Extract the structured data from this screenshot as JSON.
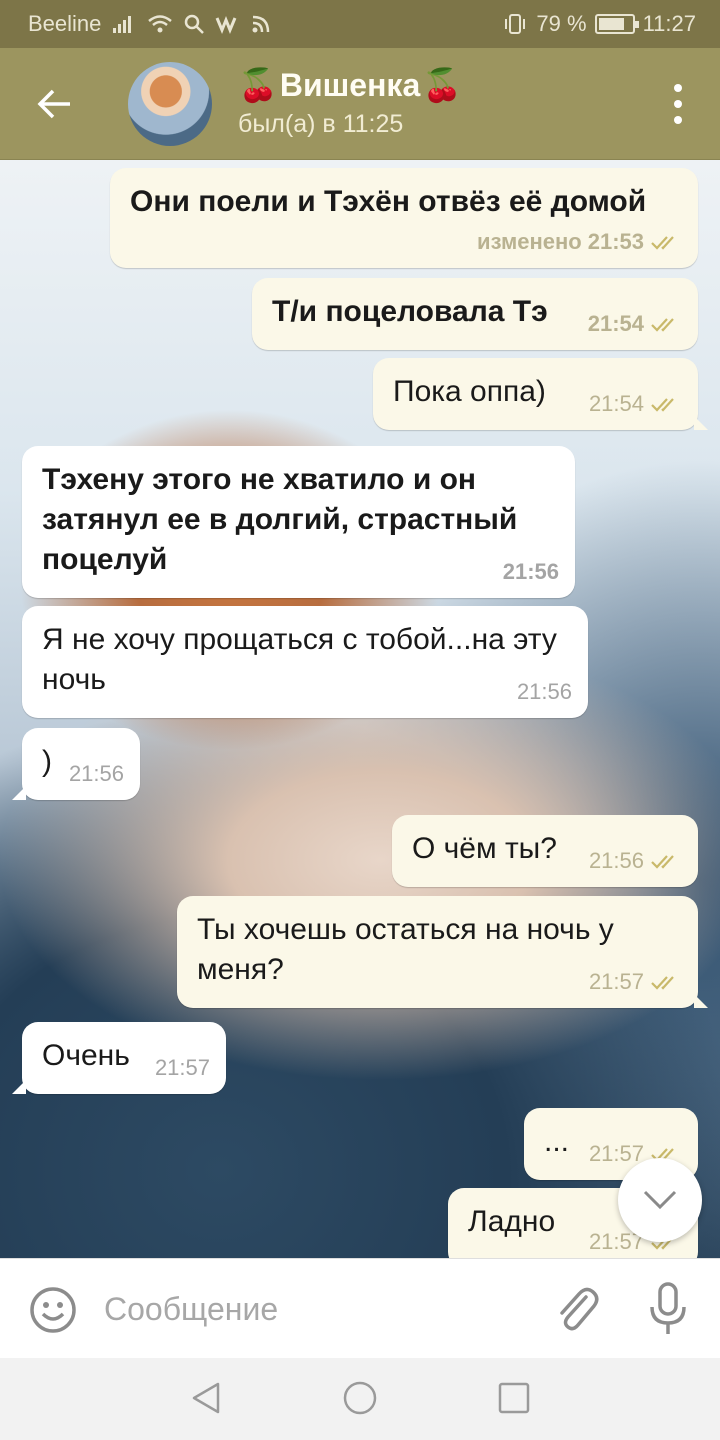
{
  "status_bar": {
    "carrier": "Beeline",
    "battery": "79 %",
    "battery_level": 0.79,
    "time": "11:27"
  },
  "header": {
    "name_emoji": "🍒",
    "name": "Вишенка",
    "status": "был(а) в 11:25"
  },
  "messages": [
    {
      "direction": "out",
      "text": "Они поели и Тэхён отвёз её домой",
      "edited": "изменено",
      "time": "21:53",
      "read": true
    },
    {
      "direction": "out",
      "text": "Т/и поцеловала Тэ",
      "time": "21:54",
      "read": true
    },
    {
      "direction": "out",
      "text": "Пока оппа)",
      "time": "21:54",
      "read": true
    },
    {
      "direction": "in",
      "text": "Тэхену этого не хватило и он затянул ее в долгий, страстный поцелуй",
      "time": "21:56"
    },
    {
      "direction": "in",
      "text": "Я не хочу прощаться с тобой...на эту ночь",
      "time": "21:56"
    },
    {
      "direction": "in",
      "text": ")",
      "time": "21:56"
    },
    {
      "direction": "out",
      "text": "О чём ты?",
      "time": "21:56",
      "read": true
    },
    {
      "direction": "out",
      "text": "Ты хочешь остаться на ночь у меня?",
      "time": "21:57",
      "read": true
    },
    {
      "direction": "in",
      "text": "Очень",
      "time": "21:57"
    },
    {
      "direction": "out",
      "text": "...",
      "time": "21:57",
      "read": true
    },
    {
      "direction": "out",
      "text": "Ладно",
      "time": "21:57",
      "read": true
    }
  ],
  "input": {
    "placeholder": "Сообщение"
  },
  "icons": {
    "back": "arrow-left-icon",
    "menu": "vertical-dots-icon",
    "emoji": "smiley-icon",
    "attach": "paperclip-icon",
    "mic": "microphone-icon",
    "scroll": "chevron-down-icon",
    "nav_back": "triangle-back-icon",
    "nav_home": "circle-home-icon",
    "nav_recent": "square-recent-icon"
  },
  "colors": {
    "header": "#9c955f",
    "status_bar": "#7d7548",
    "bubble_out": "#fbf8e8",
    "bubble_in": "#ffffff",
    "read_check": "#c9b96a"
  }
}
